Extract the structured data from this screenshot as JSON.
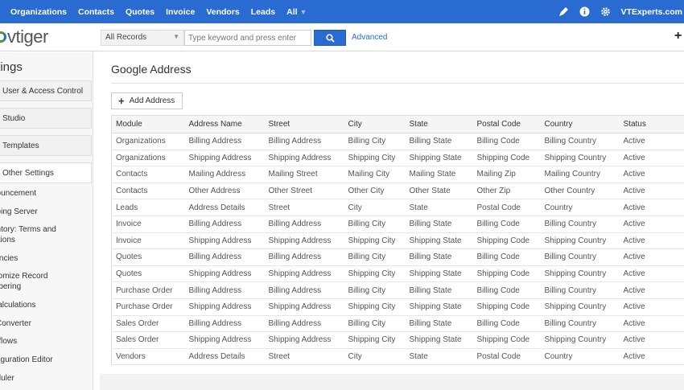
{
  "topnav": {
    "items": [
      "Organizations",
      "Contacts",
      "Quotes",
      "Invoice",
      "Vendors",
      "Leads",
      "All"
    ],
    "user": "VTExperts.com"
  },
  "logo": {
    "text": "vtiger"
  },
  "search": {
    "scope": "All Records",
    "placeholder": "Type keyword and press enter",
    "advanced_label": "Advanced"
  },
  "sidebar": {
    "title": "ttings",
    "boxes": [
      "User & Access Control",
      "Studio",
      "Templates",
      "Other Settings"
    ],
    "links": [
      "nouncement",
      "going Server",
      "entory: Terms and",
      "ditions",
      "rencies",
      "stomize Record",
      "mbering",
      "Calculations",
      "l Converter",
      "rkflows",
      "nfiguration Editor",
      "eduler"
    ]
  },
  "page": {
    "title": "Google Address",
    "add_button": "Add Address"
  },
  "table": {
    "columns": [
      "Module",
      "Address Name",
      "Street",
      "City",
      "State",
      "Postal Code",
      "Country",
      "Status"
    ],
    "rows": [
      [
        "Organizations",
        "Billing Address",
        "Billing Address",
        "Billing City",
        "Billing State",
        "Billing Code",
        "Billing Country",
        "Active"
      ],
      [
        "Organizations",
        "Shipping Address",
        "Shipping Address",
        "Shipping City",
        "Shipping State",
        "Shipping Code",
        "Shipping Country",
        "Active"
      ],
      [
        "Contacts",
        "Mailing Address",
        "Mailing Street",
        "Mailing City",
        "Mailing State",
        "Mailing Zip",
        "Mailing Country",
        "Active"
      ],
      [
        "Contacts",
        "Other Address",
        "Other Street",
        "Other City",
        "Other State",
        "Other Zip",
        "Other Country",
        "Active"
      ],
      [
        "Leads",
        "Address Details",
        "Street",
        "City",
        "State",
        "Postal Code",
        "Country",
        "Active"
      ],
      [
        "Invoice",
        "Billing Address",
        "Billing Address",
        "Billing City",
        "Billing State",
        "Billing Code",
        "Billing Country",
        "Active"
      ],
      [
        "Invoice",
        "Shipping Address",
        "Shipping Address",
        "Shipping City",
        "Shipping State",
        "Shipping Code",
        "Shipping Country",
        "Active"
      ],
      [
        "Quotes",
        "Billing Address",
        "Billing Address",
        "Billing City",
        "Billing State",
        "Billing Code",
        "Billing Country",
        "Active"
      ],
      [
        "Quotes",
        "Shipping Address",
        "Shipping Address",
        "Shipping City",
        "Shipping State",
        "Shipping Code",
        "Shipping Country",
        "Active"
      ],
      [
        "Purchase Order",
        "Billing Address",
        "Billing Address",
        "Billing City",
        "Billing State",
        "Billing Code",
        "Billing Country",
        "Active"
      ],
      [
        "Purchase Order",
        "Shipping Address",
        "Shipping Address",
        "Shipping City",
        "Shipping State",
        "Shipping Code",
        "Shipping Country",
        "Active"
      ],
      [
        "Sales Order",
        "Billing Address",
        "Billing Address",
        "Billing City",
        "Billing State",
        "Billing Code",
        "Billing Country",
        "Active"
      ],
      [
        "Sales Order",
        "Shipping Address",
        "Shipping Address",
        "Shipping City",
        "Shipping State",
        "Shipping Code",
        "Shipping Country",
        "Active"
      ],
      [
        "Vendors",
        "Address Details",
        "Street",
        "City",
        "State",
        "Postal Code",
        "Country",
        "Active"
      ]
    ]
  },
  "icons": {
    "edit": "pencil-icon",
    "help": "info-icon",
    "settings": "gear-icon",
    "search": "search-icon",
    "add": "plus-icon"
  },
  "colors": {
    "brand": "#2a6bd1",
    "logo_green": "#4a9a3a"
  }
}
